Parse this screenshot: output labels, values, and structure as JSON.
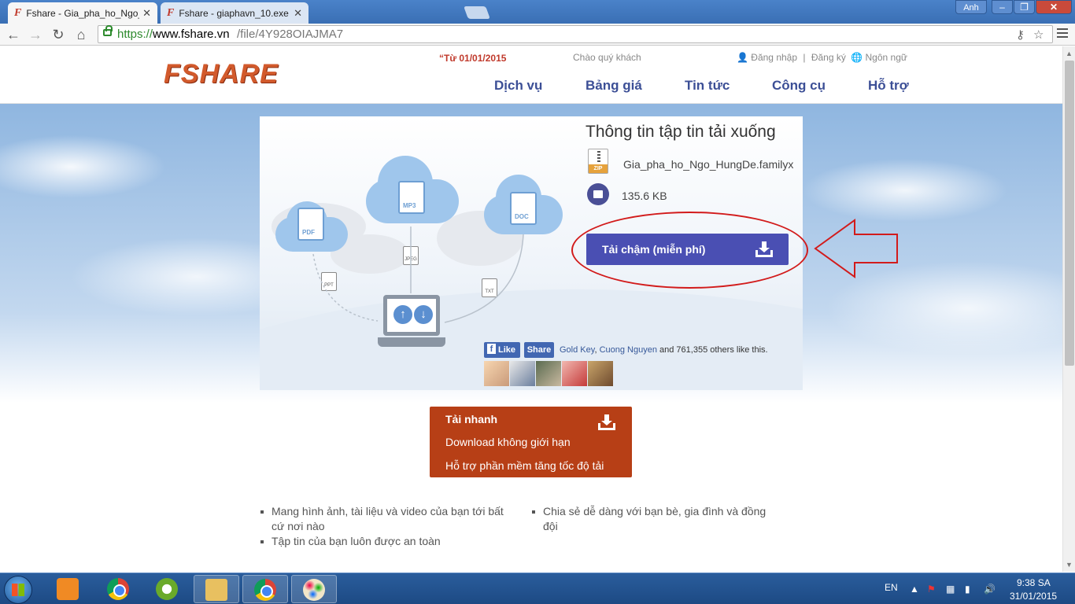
{
  "browser": {
    "tabs": [
      {
        "title": "Fshare - Gia_pha_ho_Ngo_",
        "favicon": "fshare-favicon"
      },
      {
        "title": "Fshare - giaphavn_10.exe",
        "favicon": "fshare-favicon"
      }
    ],
    "profile_label": "Anh",
    "url": {
      "scheme": "https://",
      "host": "www.fshare.vn",
      "path": "/file/4Y928OIAJMA7"
    }
  },
  "header": {
    "logo_text": "FSHARE",
    "promo": "“Từ 01/01/2015",
    "greeting": "Chào quý khách",
    "login": "Đăng nhập",
    "register": "Đăng ký",
    "language": "Ngôn ngữ",
    "nav": [
      "Dịch vụ",
      "Bảng giá",
      "Tin tức",
      "Công cụ",
      "Hỗ trợ"
    ]
  },
  "illustration": {
    "labels": [
      "PDF",
      "MP3",
      "DOC",
      "JPEG",
      "PPT",
      "TXT"
    ]
  },
  "file_info": {
    "title": "Thông tin tập tin tải xuống",
    "file_type_label": "ZIP",
    "file_name": "Gia_pha_ho_Ngo_HungDe.familyx",
    "file_size": "135.6 KB",
    "slow_download_label": "Tải chậm (miễn phí)"
  },
  "social": {
    "like_label": "Like",
    "share_label": "Share",
    "friend1": "Gold Key",
    "separator": ",",
    "friend2": "Cuong Nguyen",
    "rest": "and 761,355 others like this.",
    "avatar_count": 5
  },
  "fast_download": {
    "title": "Tải nhanh",
    "line1": "Download không giới hạn",
    "line2": "Hỗ trợ phần mềm tăng tốc độ tải"
  },
  "features": [
    "Mang hình ảnh, tài liệu và video của bạn tới bất cứ nơi nào",
    "Tập tin của bạn luôn được an toàn",
    "Chia sẻ dễ dàng với bạn bè, gia đình và đồng đội"
  ],
  "taskbar": {
    "apps": [
      "media-player-icon",
      "chrome-icon",
      "coccoc-icon",
      "file-explorer-icon",
      "chrome-icon",
      "paint-icon"
    ],
    "language": "EN",
    "time": "9:38 SA",
    "date": "31/01/2015"
  },
  "colors": {
    "nav_text": "#3c4f96",
    "slow_button": "#4a4fb3",
    "fast_box": "#b73f16",
    "annotation_red": "#d21b1b",
    "logo": "#d25a2c"
  }
}
